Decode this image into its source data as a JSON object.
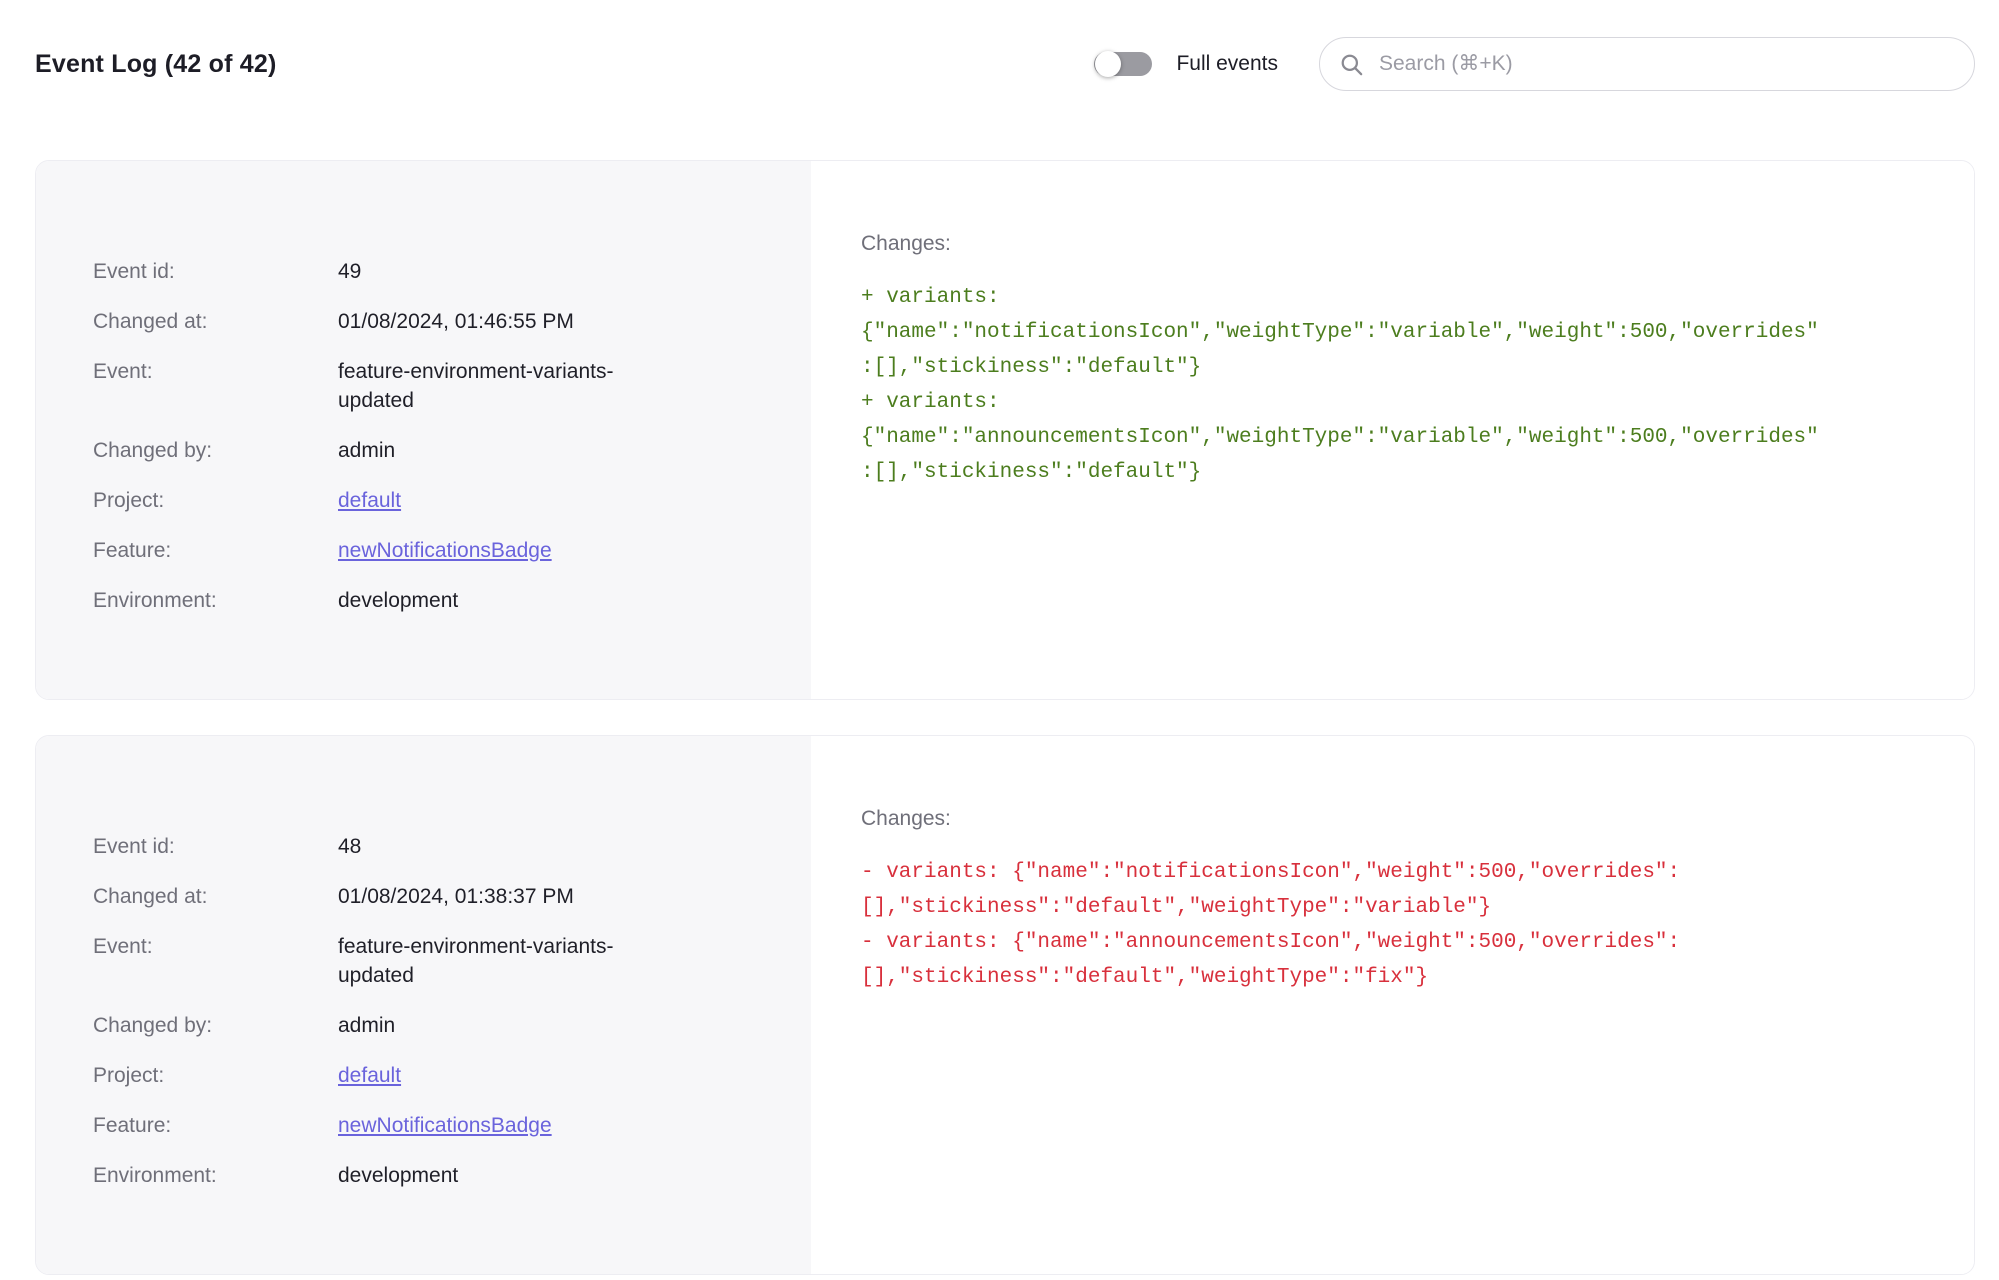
{
  "page": {
    "title": "Event Log (42 of 42)"
  },
  "header": {
    "toggle_label": "Full events",
    "toggle_state": "off",
    "search_placeholder": "Search (⌘+K)"
  },
  "icons": {
    "search": "magnifier-glyph"
  },
  "colors": {
    "addition": "#4c7d1e",
    "deletion": "#d8303c",
    "link": "#6a63dc",
    "label": "#6f6f79",
    "value": "#1f1f28",
    "panel": "#f7f7f9"
  },
  "cards": [
    {
      "meta": [
        {
          "label": "Event id:",
          "value": "49"
        },
        {
          "label": "Changed at:",
          "value": "01/08/2024, 01:46:55 PM"
        },
        {
          "label": "Event:",
          "value": "feature-environment-variants-updated"
        },
        {
          "label": "Changed by:",
          "value": "admin"
        },
        {
          "label": "Project:",
          "value": "default"
        },
        {
          "label": "Feature:",
          "value": "newNotificationsBadge"
        },
        {
          "label": "Environment:",
          "value": "development"
        }
      ],
      "changes_label": "Changes:",
      "diff": [
        {
          "kind": "addition",
          "text": "+ variants:\n{\"name\":\"notificationsIcon\",\"weightType\":\"variable\",\"weight\":500,\"overrides\"\n:[],\"stickiness\":\"default\"}"
        },
        {
          "kind": "addition",
          "text": "+ variants:\n{\"name\":\"announcementsIcon\",\"weightType\":\"variable\",\"weight\":500,\"overrides\"\n:[],\"stickiness\":\"default\"}"
        }
      ]
    },
    {
      "meta": [
        {
          "label": "Event id:",
          "value": "48"
        },
        {
          "label": "Changed at:",
          "value": "01/08/2024, 01:38:37 PM"
        },
        {
          "label": "Event:",
          "value": "feature-environment-variants-updated"
        },
        {
          "label": "Changed by:",
          "value": "admin"
        },
        {
          "label": "Project:",
          "value": "default"
        },
        {
          "label": "Feature:",
          "value": "newNotificationsBadge"
        },
        {
          "label": "Environment:",
          "value": "development"
        }
      ],
      "changes_label": "Changes:",
      "diff": [
        {
          "kind": "deletion",
          "text": "- variants: {\"name\":\"notificationsIcon\",\"weight\":500,\"overrides\":\n[],\"stickiness\":\"default\",\"weightType\":\"variable\"}"
        },
        {
          "kind": "deletion",
          "text": "- variants: {\"name\":\"announcementsIcon\",\"weight\":500,\"overrides\":\n[],\"stickiness\":\"default\",\"weightType\":\"fix\"}"
        }
      ]
    }
  ]
}
